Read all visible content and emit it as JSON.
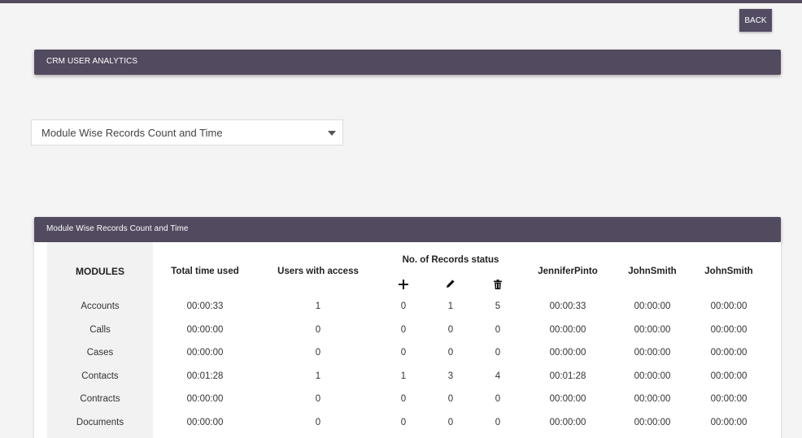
{
  "header": {
    "back_label": "BACK"
  },
  "analytics_panel": {
    "title": "CRM USER ANALYTICS"
  },
  "report_select": {
    "value": "Module Wise Records Count and Time"
  },
  "report_panel": {
    "title": "Module Wise Records Count and Time"
  },
  "table": {
    "headers": {
      "modules": "MODULES",
      "total_time": "Total time used",
      "users_access": "Users with access",
      "records_status": "No. of Records status",
      "user1": "JenniferPinto",
      "user2": "JohnSmith",
      "user3": "JohnSmith"
    },
    "status_icons": [
      "plus-icon",
      "pencil-icon",
      "trash-icon"
    ],
    "rows": [
      {
        "module": "Accounts",
        "total": "00:00:33",
        "users": "1",
        "created": "0",
        "edited": "1",
        "deleted": "5",
        "u1": "00:00:33",
        "u2": "00:00:00",
        "u3": "00:00:00"
      },
      {
        "module": "Calls",
        "total": "00:00:00",
        "users": "0",
        "created": "0",
        "edited": "0",
        "deleted": "0",
        "u1": "00:00:00",
        "u2": "00:00:00",
        "u3": "00:00:00"
      },
      {
        "module": "Cases",
        "total": "00:00:00",
        "users": "0",
        "created": "0",
        "edited": "0",
        "deleted": "0",
        "u1": "00:00:00",
        "u2": "00:00:00",
        "u3": "00:00:00"
      },
      {
        "module": "Contacts",
        "total": "00:01:28",
        "users": "1",
        "created": "1",
        "edited": "3",
        "deleted": "4",
        "u1": "00:01:28",
        "u2": "00:00:00",
        "u3": "00:00:00"
      },
      {
        "module": "Contracts",
        "total": "00:00:00",
        "users": "0",
        "created": "0",
        "edited": "0",
        "deleted": "0",
        "u1": "00:00:00",
        "u2": "00:00:00",
        "u3": "00:00:00"
      },
      {
        "module": "Documents",
        "total": "00:00:00",
        "users": "0",
        "created": "0",
        "edited": "0",
        "deleted": "0",
        "u1": "00:00:00",
        "u2": "00:00:00",
        "u3": "00:00:00"
      }
    ]
  }
}
